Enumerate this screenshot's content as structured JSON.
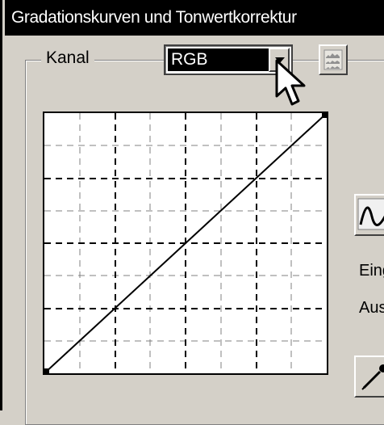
{
  "window": {
    "title": "Gradationskurven und Tonwertkorrektur"
  },
  "channel": {
    "label": "Kanal",
    "selected": "RGB"
  },
  "side": {
    "input_label": "Eing",
    "output_label": "Aus"
  },
  "icons": {
    "dropdown": "chevron-down-icon",
    "histogram": "histogram-icon",
    "curve_tool": "curve-icon",
    "eyedropper": "eyedropper-icon",
    "cursor": "cursor-arrow-icon"
  },
  "colors": {
    "title_bar": "#000000",
    "face": "#d4d0c8",
    "selection": "#000000"
  }
}
